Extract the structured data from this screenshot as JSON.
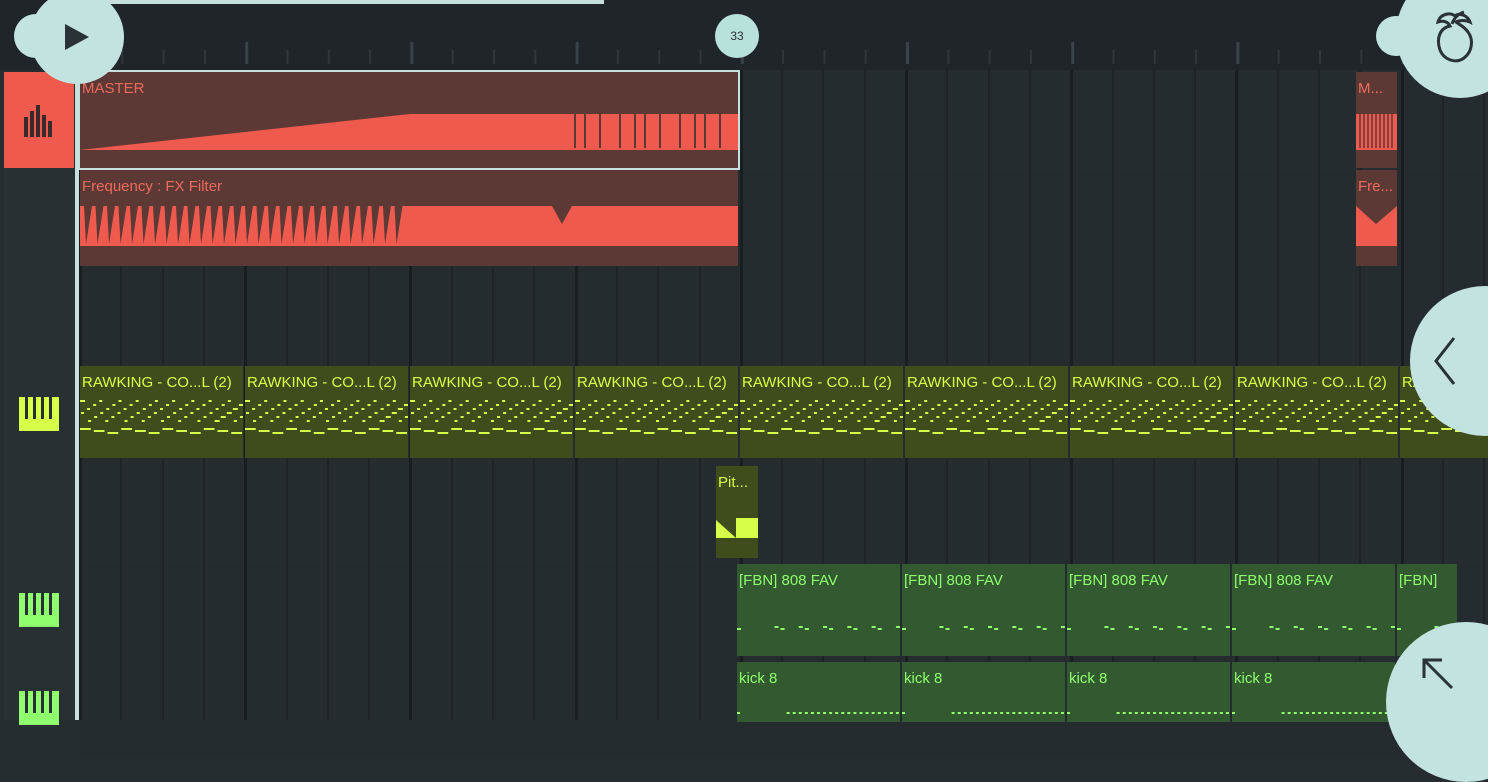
{
  "timeline": {
    "beat_marker": "33"
  },
  "controls": {
    "play_icon": "play-icon",
    "logo_icon": "fruit-logo-icon",
    "collapse_icon": "chevron-left-icon",
    "expand_icon": "arrow-up-left-icon"
  },
  "tracks": [
    {
      "icon": "mixer-bars-icon",
      "color": "#ee5a4e"
    },
    {
      "icon": "",
      "color": ""
    },
    {
      "icon": "",
      "color": ""
    },
    {
      "icon": "piano-keys-icon",
      "color": "#d7ff4a"
    },
    {
      "icon": "",
      "color": ""
    },
    {
      "icon": "piano-keys-icon",
      "color": "#8fff6e"
    },
    {
      "icon": "piano-keys-icon",
      "color": "#8fff6e"
    }
  ],
  "clips": {
    "master": {
      "label": "MASTER"
    },
    "master_short": {
      "label": "M..."
    },
    "filter": {
      "label": "Frequency : FX Filter"
    },
    "filter_short": {
      "label": "Fre..."
    },
    "rawking": [
      "RAWKING - CO...L (2)",
      "RAWKING - CO...L (2)",
      "RAWKING - CO...L (2)",
      "RAWKING - CO...L (2)",
      "RAWKING - CO...L (2)",
      "RAWKING - CO...L (2)",
      "RAWKING - CO...L (2)",
      "RAWKING - CO...L (2)",
      "RA"
    ],
    "pitch": {
      "label": "Pit..."
    },
    "fbn": [
      "[FBN] 808 FAV",
      "[FBN] 808 FAV",
      "[FBN] 808 FAV",
      "[FBN] 808 FAV",
      "[FBN]"
    ],
    "kick": [
      "kick 8",
      "kick 8",
      "kick 8",
      "kick 8"
    ]
  },
  "colors": {
    "accent_red": "#ee5a4e",
    "accent_lime": "#d7ff4a",
    "accent_green": "#8fff6e",
    "ui_mint": "#c2e3df"
  }
}
